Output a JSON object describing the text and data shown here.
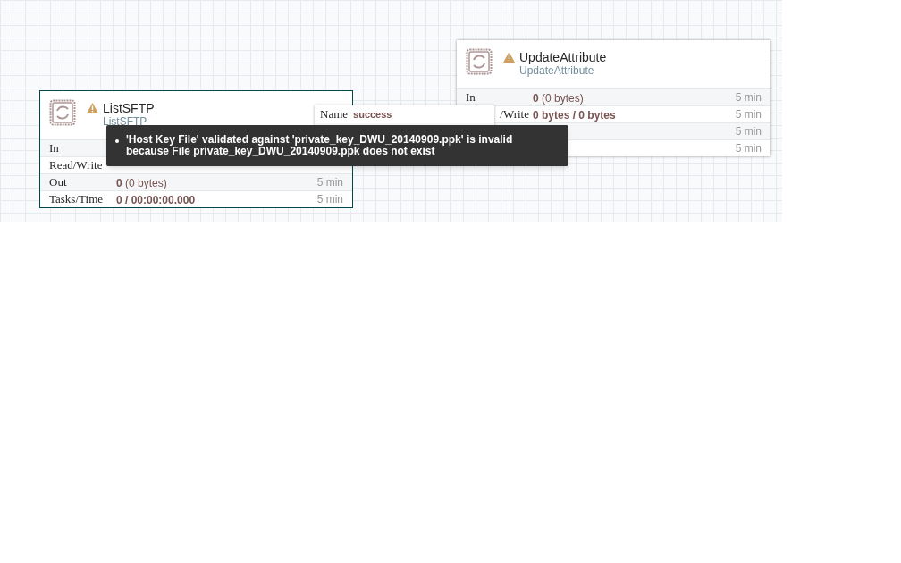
{
  "processors": [
    {
      "name": "ListSFTP",
      "type": "ListSFTP",
      "selected": true,
      "warning": true,
      "stats": [
        {
          "label": "In",
          "clipped": false
        },
        {
          "label": "Read/Write",
          "clipped": false
        },
        {
          "label": "Out",
          "clipped": false,
          "value": "**0** (0 bytes)",
          "time": "5 min"
        },
        {
          "label": "Tasks/Time",
          "clipped": false,
          "value": "**0 / 00:00:00.000**",
          "time": "5 min"
        }
      ]
    },
    {
      "name": "UpdateAttribute",
      "type": "UpdateAttribute",
      "selected": false,
      "warning": true,
      "stats": [
        {
          "label": "In",
          "clipped": false,
          "value": "**0** (0 bytes)",
          "time": "5 min"
        },
        {
          "label": "/Write",
          "clipped": true,
          "value": "**0 bytes / 0 bytes**",
          "time": "5 min"
        },
        {
          "time": "5 min"
        },
        {
          "time": "5 min"
        }
      ]
    }
  ],
  "connection": {
    "name_label": "Name",
    "name": "success"
  },
  "tooltip": {
    "messages": [
      "'Host Key File' validated against 'private_key_DWU_20140909.ppk' is invalid because File private_key_DWU_20140909.ppk does not exist"
    ]
  }
}
